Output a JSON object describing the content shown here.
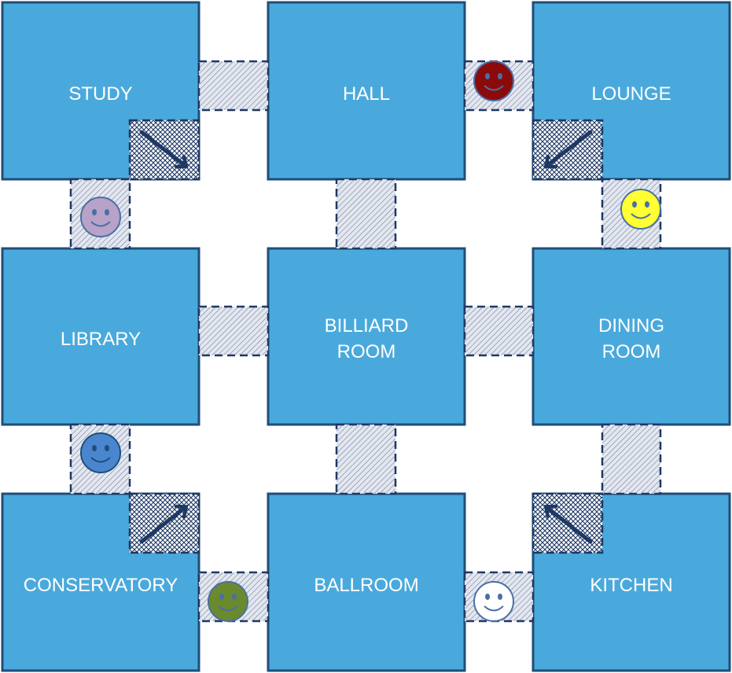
{
  "colors": {
    "room_fill": "#4aa9dc",
    "room_border": "#1f4e79",
    "hallway_fill": "#d9dde5",
    "hallway_hatch": "#2b4a78",
    "secret_hatch": "#1f3864",
    "arrow": "#1f3864"
  },
  "rooms": {
    "study": "STUDY",
    "hall": "HALL",
    "lounge": "LOUNGE",
    "library": "LIBRARY",
    "billiard_line1": "BILLIARD",
    "billiard_line2": "ROOM",
    "dining_line1": "DINING",
    "dining_line2": "ROOM",
    "conservatory": "CONSERVATORY",
    "ballroom": "BALLROOM",
    "kitchen": "KITCHEN"
  },
  "tokens": [
    {
      "name": "red-token",
      "color": "#8b0a0a"
    },
    {
      "name": "yellow-token",
      "color": "#ffff33"
    },
    {
      "name": "lavender-token",
      "color": "#b8a2c8"
    },
    {
      "name": "blue-token",
      "color": "#4a86d0"
    },
    {
      "name": "green-token",
      "color": "#6b8a2e"
    },
    {
      "name": "white-token",
      "color": "#ffffff"
    }
  ],
  "secret_passages": [
    {
      "room": "study",
      "direction": "down-right"
    },
    {
      "room": "lounge",
      "direction": "down-left"
    },
    {
      "room": "conservatory",
      "direction": "up-right"
    },
    {
      "room": "kitchen",
      "direction": "up-left"
    }
  ]
}
